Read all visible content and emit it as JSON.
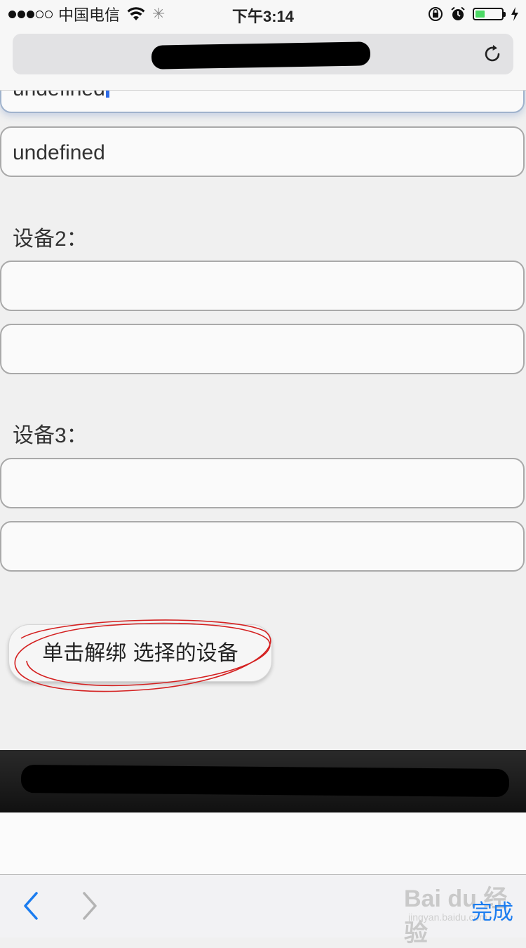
{
  "status_bar": {
    "carrier": "中国电信",
    "time": "下午3:14",
    "signal_full": 3,
    "signal_total": 5,
    "battery_level": 0.35,
    "battery_color": "#4cd964"
  },
  "address_bar": {
    "url_redacted": true,
    "reload_icon": "reload-icon"
  },
  "form": {
    "device1_field1_value": "undefined",
    "device1_field2_value": "undefined",
    "device2_label": "设备2：",
    "device3_label": "设备3：",
    "unbind_button_label": "单击解绑 选择的设备"
  },
  "toolbar": {
    "back_icon": "chevron-left-icon",
    "forward_icon": "chevron-right-icon",
    "done_label": "完成",
    "accent_color": "#1a7cf0"
  },
  "watermark": {
    "brand": "Bai du 经验",
    "sub": "jingyan.baidu.com"
  }
}
